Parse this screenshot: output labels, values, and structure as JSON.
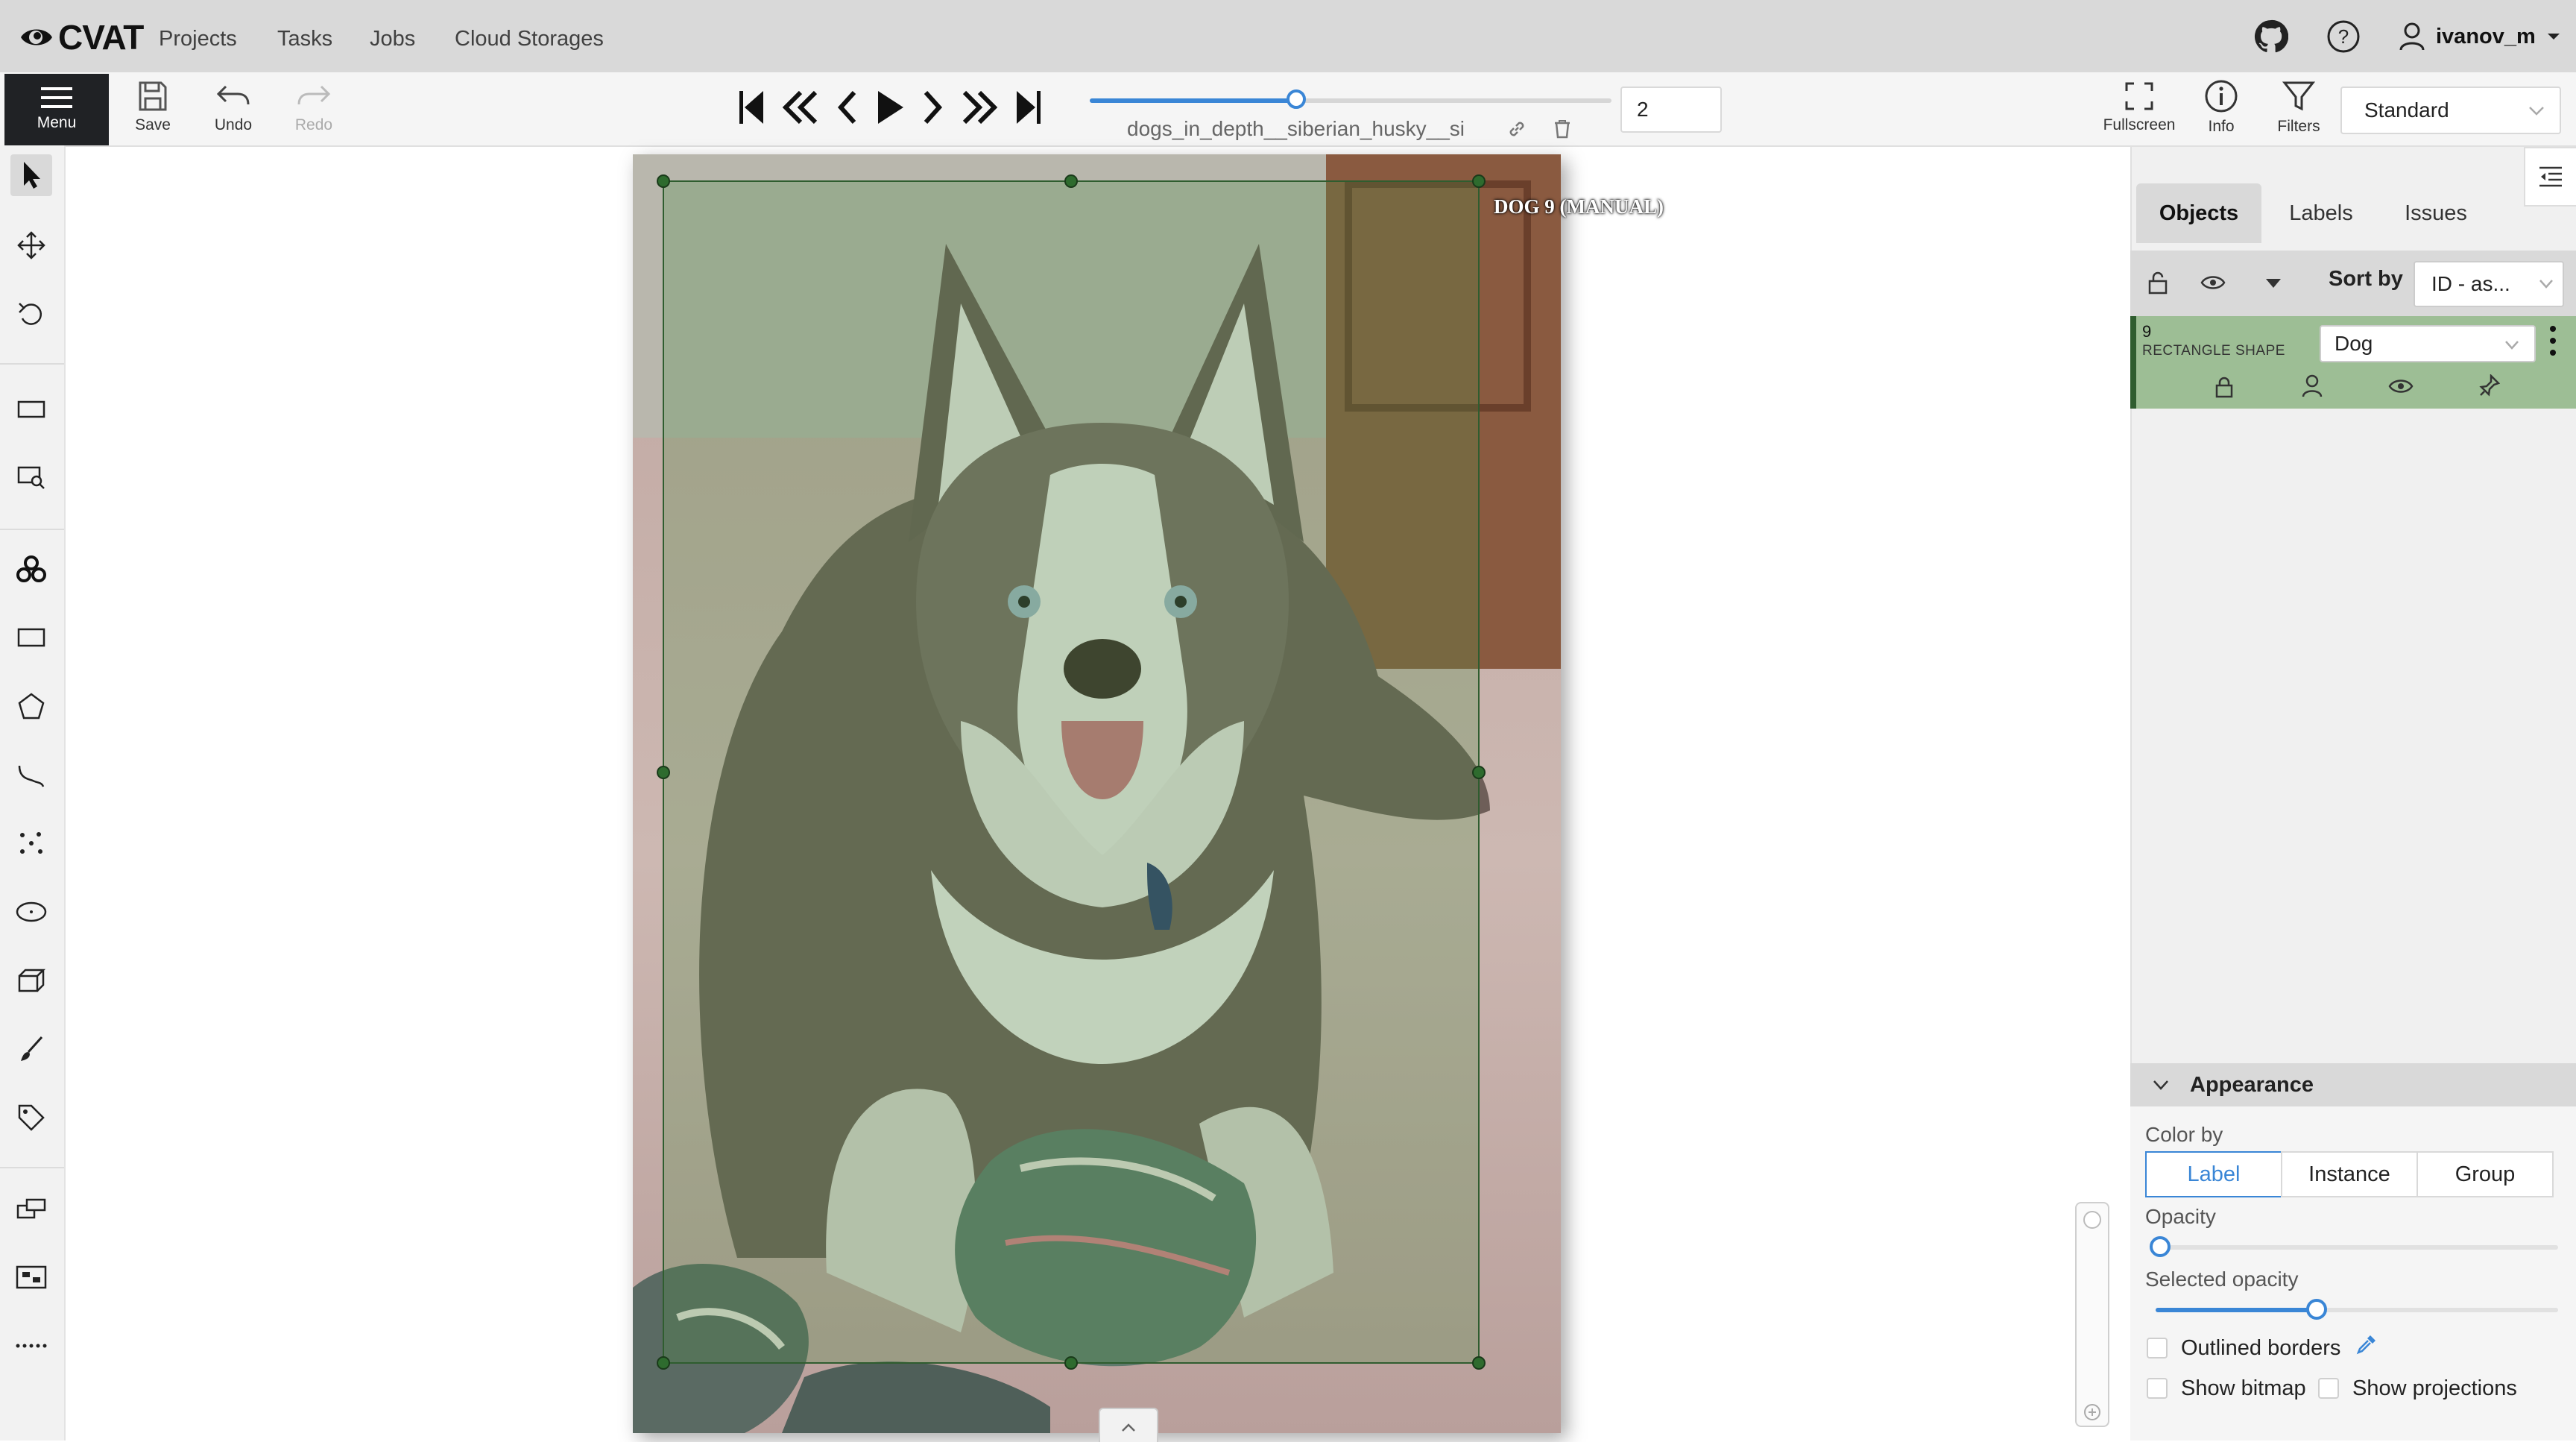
{
  "header": {
    "logo_text": "CVAT",
    "nav": [
      "Projects",
      "Tasks",
      "Jobs",
      "Cloud Storages"
    ],
    "username": "ivanov_m"
  },
  "toolbar": {
    "menu_label": "Menu",
    "save_label": "Save",
    "undo_label": "Undo",
    "redo_label": "Redo",
    "filename": "dogs_in_depth__siberian_husky__si",
    "frame_number": "2",
    "fullscreen_label": "Fullscreen",
    "info_label": "Info",
    "filters_label": "Filters",
    "workspace": "Standard"
  },
  "annotation": {
    "object_label": "DOG 9 (MANUAL)"
  },
  "sidebar": {
    "tabs": [
      "Objects",
      "Labels",
      "Issues"
    ],
    "sort_by_label": "Sort by",
    "sort_value": "ID - as...",
    "object": {
      "id": "9",
      "type": "RECTANGLE SHAPE",
      "label": "Dog"
    },
    "appearance": {
      "title": "Appearance",
      "color_by_label": "Color by",
      "color_by_options": [
        "Label",
        "Instance",
        "Group"
      ],
      "color_by_selected": "Label",
      "opacity_label": "Opacity",
      "opacity_value": 0.0,
      "selected_opacity_label": "Selected opacity",
      "selected_opacity_value": 0.4,
      "outlined_borders_label": "Outlined borders",
      "show_bitmap_label": "Show bitmap",
      "show_projections_label": "Show projections"
    }
  },
  "colors": {
    "accent": "#3a86d6",
    "box_stroke": "#2f5d2f",
    "object_card": "#9dbe95"
  }
}
